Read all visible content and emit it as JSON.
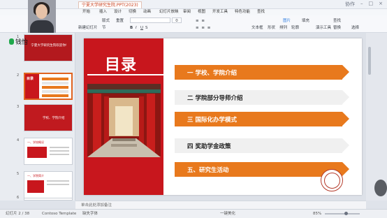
{
  "titlebar": {
    "doc_tab": "宁夏大学研究生院.PPT(2023)",
    "right_label": "协作"
  },
  "ribbon_tabs": [
    "开始",
    "插入",
    "设计",
    "切换",
    "动画",
    "幻灯片放映",
    "审阅",
    "视图",
    "开发工具",
    "特色功能",
    "查找"
  ],
  "ribbon": {
    "paste": "新建幻灯片",
    "layout": "版式",
    "reset": "重置",
    "section": "节",
    "font_size": "0",
    "text_box": "文本框",
    "shapes": "形状",
    "arrange": "排列",
    "picture": "图片",
    "outline": "轮廓",
    "fill": "填充",
    "find": "查找",
    "replace": "替换",
    "select": "选择",
    "quick_tools": "演示工具"
  },
  "speaker": {
    "name": "钱怡"
  },
  "thumbnails": [
    {
      "num": "1",
      "title": "宁夏大学研究生院欢迎你!",
      "bg": "#b3191e"
    },
    {
      "num": "2",
      "title": "目录",
      "bg": "#ffffff"
    },
    {
      "num": "3",
      "title": "学校、学院介绍",
      "bg": "#c01a1f"
    },
    {
      "num": "4",
      "title": "一、学校概况",
      "bg": "#ffffff"
    },
    {
      "num": "5",
      "title": "一、学院简介",
      "bg": "#ffffff"
    },
    {
      "num": "6",
      "title": "",
      "bg": "#ffffff"
    }
  ],
  "slide": {
    "title": "目录",
    "items": [
      {
        "text": "一  学校、学院介绍",
        "style": "orange"
      },
      {
        "text": "二  学院部分导师介绍",
        "style": "gray"
      },
      {
        "text": "三  国际化办学模式",
        "style": "orange"
      },
      {
        "text": "四    奖助学金政策",
        "style": "gray"
      },
      {
        "text": "五、研究生活动",
        "style": "orange"
      }
    ]
  },
  "notes": {
    "placeholder": "单击此处添加备注"
  },
  "statusbar": {
    "slide_count": "幻灯片 2 / 38",
    "theme": "Contoso Template",
    "status": "缺失字体",
    "zoom": "85%",
    "beautify": "一键美化"
  },
  "colors": {
    "accent_orange": "#e8791d",
    "accent_red": "#c8161d"
  }
}
